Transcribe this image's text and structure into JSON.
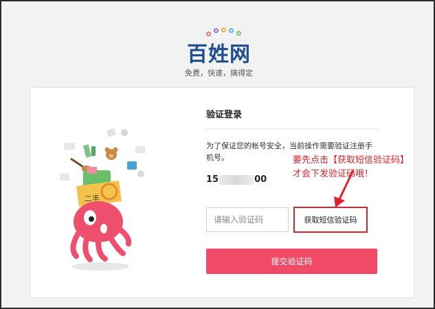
{
  "brand": {
    "logo_text": "百姓网",
    "slogan": "免费，快速，搞得定",
    "dot_colors": [
      "#e8736a",
      "#8a75c9",
      "#f2b233",
      "#5bb4e0",
      "#7bc96f"
    ]
  },
  "form": {
    "title": "验证登录",
    "description": "为了保证您的帐号安全，当前操作需要验证注册手机号。",
    "phone_prefix": "15",
    "phone_suffix": "00",
    "code_placeholder": "请输入验证码",
    "get_code_label": "获取短信验证码",
    "submit_label": "提交验证码"
  },
  "annotation": {
    "line1": "要先点击【获取短信验证码】",
    "line2": "才会下发验证码哦！"
  },
  "colors": {
    "accent": "#f04a67",
    "highlight": "#e0222b",
    "brand_blue": "#1f4f8f"
  }
}
